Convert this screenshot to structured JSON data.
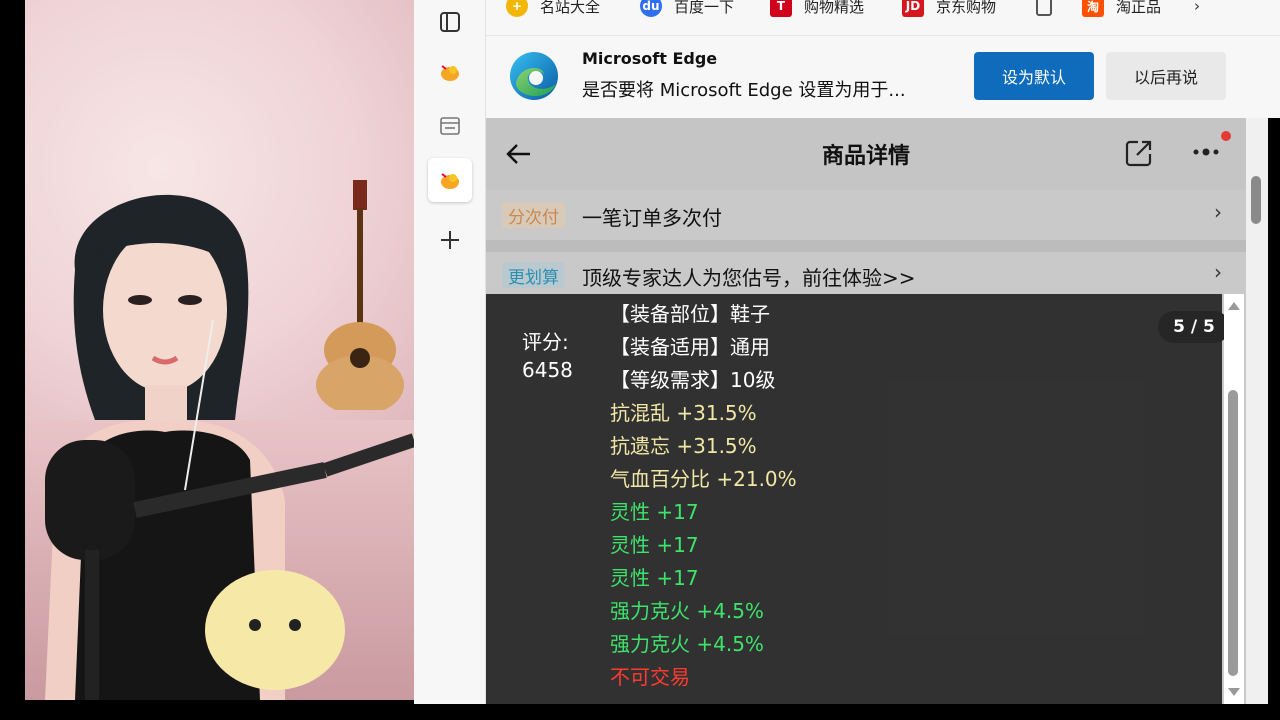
{
  "favorites": [
    {
      "label": "名站大全",
      "icon": "add-site-icon",
      "color": "#f2b705"
    },
    {
      "label": "百度一下",
      "icon": "baidu-paw-icon",
      "color": "#2f6ff0"
    },
    {
      "label": "购物精选",
      "icon": "shopping-icon",
      "color": "#d0021b"
    },
    {
      "label": "京东购物",
      "icon": "jd-icon",
      "color": "#d6161d"
    },
    {
      "label": "",
      "icon": "page-icon",
      "color": "#555555"
    },
    {
      "label": "淘正品",
      "icon": "taobao-icon",
      "color": "#ff5000"
    }
  ],
  "banner": {
    "title": "Microsoft Edge",
    "message": "是否要将 Microsoft Edge 设置为用于...",
    "primary_button": "设为默认",
    "secondary_button": "以后再说"
  },
  "page": {
    "title": "商品详情",
    "rows": [
      {
        "tag": "分次付",
        "text": "一笔订单多次付",
        "tag_bg": "#d8c9b8",
        "tag_color": "#c9894e"
      },
      {
        "tag": "更划算",
        "text": "顶级专家达人为您估号，前往体验>>",
        "tag_bg": "#b9c9cf",
        "tag_color": "#2b8fb0"
      }
    ]
  },
  "tooltip": {
    "score_label": "评分:",
    "score_value": "6458",
    "pager": "5 / 5",
    "lines": [
      {
        "text": "【装备部位】鞋子",
        "color": "#ffffff"
      },
      {
        "text": "【装备适用】通用",
        "color": "#ffffff"
      },
      {
        "text": "【等级需求】10级",
        "color": "#ffffff"
      },
      {
        "text": "抗混乱 +31.5%",
        "color": "#f1e7a6"
      },
      {
        "text": "抗遗忘 +31.5%",
        "color": "#f1e7a6"
      },
      {
        "text": "气血百分比 +21.0%",
        "color": "#f1e7a6"
      },
      {
        "text": "灵性 +17",
        "color": "#3ee36b"
      },
      {
        "text": "灵性 +17",
        "color": "#3ee36b"
      },
      {
        "text": "灵性 +17",
        "color": "#3ee36b"
      },
      {
        "text": "强力克火 +4.5%",
        "color": "#3ee36b"
      },
      {
        "text": "强力克火 +4.5%",
        "color": "#3ee36b"
      },
      {
        "text": "不可交易",
        "color": "#ff3b30"
      }
    ]
  }
}
